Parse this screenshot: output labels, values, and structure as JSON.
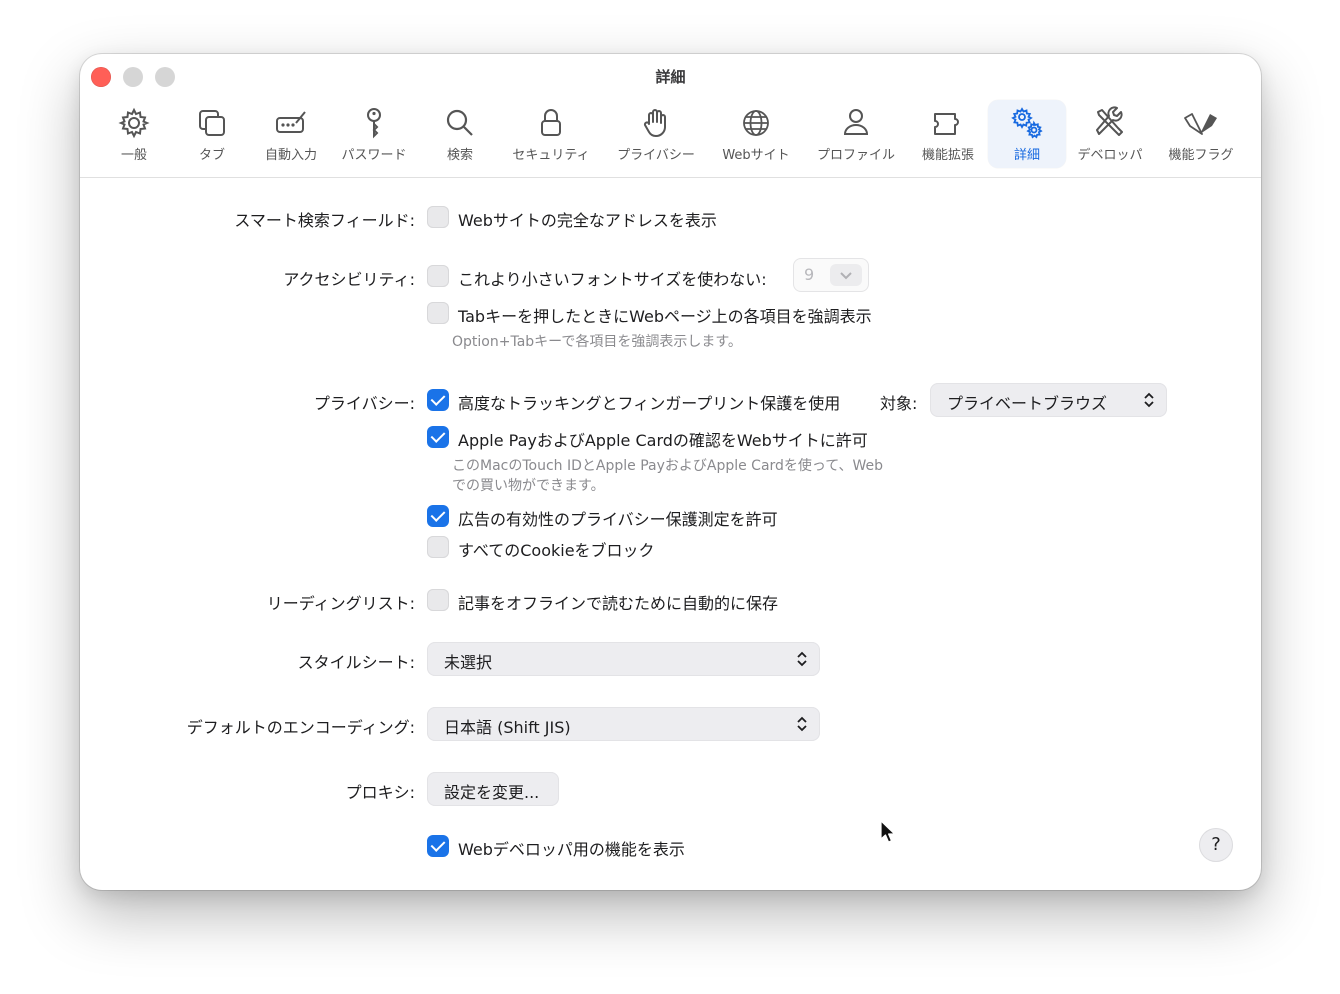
{
  "window": {
    "title": "詳細"
  },
  "toolbar": {
    "items": [
      {
        "label": "一般",
        "icon": "gear-icon"
      },
      {
        "label": "タブ",
        "icon": "tabs-icon"
      },
      {
        "label": "自動入力",
        "icon": "autofill-icon"
      },
      {
        "label": "パスワード",
        "icon": "key-icon"
      },
      {
        "label": "検索",
        "icon": "search-icon"
      },
      {
        "label": "セキュリティ",
        "icon": "lock-icon"
      },
      {
        "label": "プライバシー",
        "icon": "hand-icon"
      },
      {
        "label": "Webサイト",
        "icon": "globe-icon"
      },
      {
        "label": "プロファイル",
        "icon": "person-icon"
      },
      {
        "label": "機能拡張",
        "icon": "puzzle-icon"
      },
      {
        "label": "詳細",
        "icon": "gears-icon",
        "selected": true
      },
      {
        "label": "デベロッパ",
        "icon": "tools-icon"
      },
      {
        "label": "機能フラグ",
        "icon": "flags-icon"
      }
    ]
  },
  "settings": {
    "smart_search": {
      "label": "スマート検索フィールド:",
      "show_full_address": {
        "label": "Webサイトの完全なアドレスを表示",
        "checked": false
      }
    },
    "accessibility": {
      "label": "アクセシビリティ:",
      "min_font": {
        "label": "これより小さいフォントサイズを使わない:",
        "checked": false,
        "value": "9"
      },
      "tab_highlight": {
        "label": "Tabキーを押したときにWebページ上の各項目を強調表示",
        "checked": false
      },
      "tab_note": "Option+Tabキーで各項目を強調表示します。"
    },
    "privacy": {
      "label": "プライバシー:",
      "tracking": {
        "label": "高度なトラッキングとフィンガープリント保護を使用",
        "checked": true
      },
      "target_label": "対象:",
      "target_value": "プライベートブラウズ",
      "apple_pay": {
        "label": "Apple PayおよびApple Cardの確認をWebサイトに許可",
        "checked": true
      },
      "apple_pay_note_1": "このMacのTouch IDとApple PayおよびApple Cardを使って、Web",
      "apple_pay_note_2": "での買い物ができます。",
      "ad_measurement": {
        "label": "広告の有効性のプライバシー保護測定を許可",
        "checked": true
      },
      "block_cookies": {
        "label": "すべてのCookieをブロック",
        "checked": false
      }
    },
    "reading_list": {
      "label": "リーディングリスト:",
      "save_offline": {
        "label": "記事をオフラインで読むために自動的に保存",
        "checked": false
      }
    },
    "stylesheet": {
      "label": "スタイルシート:",
      "value": "未選択"
    },
    "encoding": {
      "label": "デフォルトのエンコーディング:",
      "value": "日本語 (Shift JIS)"
    },
    "proxy": {
      "label": "プロキシ:",
      "button": "設定を変更..."
    },
    "web_developer": {
      "label": "Webデベロッパ用の機能を表示",
      "checked": true
    }
  },
  "help_button": "?",
  "colors": {
    "accent": "#1a73e8",
    "close": "#ff5f57",
    "selected_tab_text": "#1769e0"
  }
}
